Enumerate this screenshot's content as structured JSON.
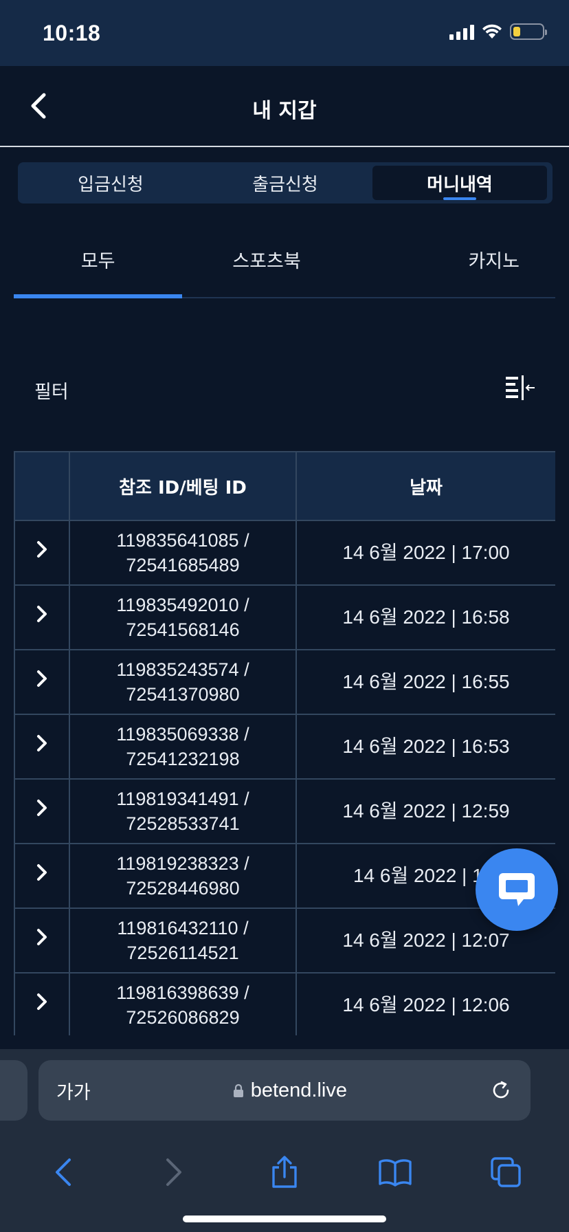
{
  "status_bar": {
    "time": "10:18"
  },
  "header": {
    "title": "내 지갑"
  },
  "segment_tabs": [
    {
      "label": "입금신청",
      "active": false
    },
    {
      "label": "출금신청",
      "active": false
    },
    {
      "label": "머니내역",
      "active": true
    }
  ],
  "sub_tabs": [
    {
      "label": "모두",
      "active": true
    },
    {
      "label": "스포츠북",
      "active": false
    },
    {
      "label": "카지노",
      "active": false
    }
  ],
  "filter": {
    "label": "필터"
  },
  "table": {
    "headers": [
      "",
      "참조 ID/베팅 ID",
      "날짜"
    ],
    "rows": [
      {
        "ref_id": "119835641085 /",
        "bet_id": "72541685489",
        "date": "14 6월 2022 | 17:00"
      },
      {
        "ref_id": "119835492010 /",
        "bet_id": "72541568146",
        "date": "14 6월 2022 | 16:58"
      },
      {
        "ref_id": "119835243574 /",
        "bet_id": "72541370980",
        "date": "14 6월 2022 | 16:55"
      },
      {
        "ref_id": "119835069338 /",
        "bet_id": "72541232198",
        "date": "14 6월 2022 | 16:53"
      },
      {
        "ref_id": "119819341491 /",
        "bet_id": "72528533741",
        "date": "14 6월 2022 | 12:59"
      },
      {
        "ref_id": "119819238323 /",
        "bet_id": "72528446980",
        "date": "14 6월 2022 | 12:"
      },
      {
        "ref_id": "119816432110 /",
        "bet_id": "72526114521",
        "date": "14 6월 2022 | 12:07"
      },
      {
        "ref_id": "119816398639 /",
        "bet_id": "72526086829",
        "date": "14 6월 2022 | 12:06"
      }
    ]
  },
  "browser": {
    "text_size_label": "가가",
    "url": "betend.live"
  },
  "colors": {
    "background": "#0b1628",
    "panel": "#152a47",
    "accent": "#3a86f0",
    "border": "#33475f"
  },
  "icons": [
    "back-chevron-icon",
    "filter-columns-icon",
    "expand-chevron-icon",
    "chat-bubble-icon",
    "lock-icon",
    "reload-icon",
    "back-arrow-icon",
    "forward-arrow-icon",
    "share-icon",
    "bookmarks-icon",
    "tabs-icon"
  ]
}
